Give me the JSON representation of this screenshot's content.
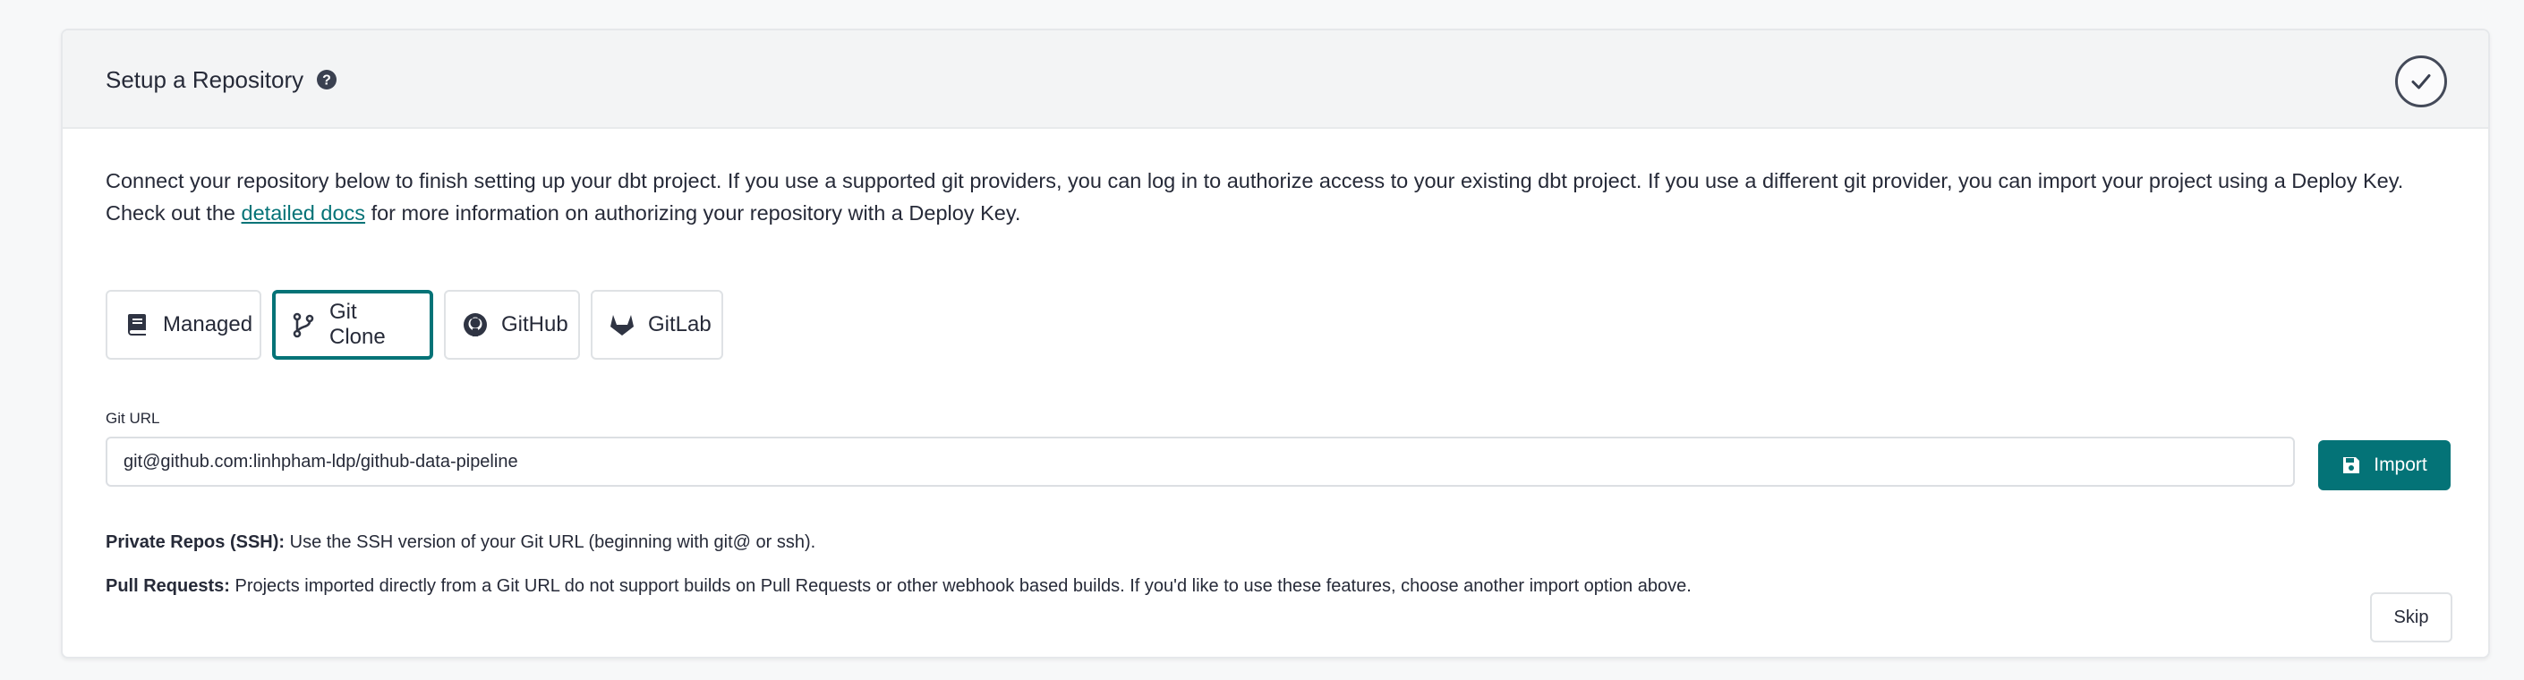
{
  "header": {
    "title": "Setup a Repository",
    "help_icon": "question-circle-icon",
    "status_icon": "check-circle-icon"
  },
  "intro": {
    "text_before_link": "Connect your repository below to finish setting up your dbt project. If you use a supported git providers, you can log in to authorize access to your existing dbt project. If you use a different git provider, you can import your project using a Deploy Key. Check out the ",
    "link_text": "detailed docs",
    "text_after_link": " for more information on authorizing your repository with a Deploy Key."
  },
  "options": [
    {
      "label": "Managed",
      "icon": "book-icon",
      "selected": false
    },
    {
      "label": "Git Clone",
      "icon": "git-branch-icon",
      "selected": true
    },
    {
      "label": "GitHub",
      "icon": "github-icon",
      "selected": false
    },
    {
      "label": "GitLab",
      "icon": "gitlab-icon",
      "selected": false
    }
  ],
  "git_url": {
    "label": "Git URL",
    "value": "git@github.com:linhpham-ldp/github-data-pipeline"
  },
  "import_button": {
    "label": "Import",
    "icon": "save-icon"
  },
  "help": {
    "ssh_title": "Private Repos (SSH):",
    "ssh_text": " Use the SSH version of your Git URL (beginning with git@ or ssh).",
    "pr_title": "Pull Requests:",
    "pr_text": " Projects imported directly from a Git URL do not support builds on Pull Requests or other webhook based builds. If you'd like to use these features, choose another import option above."
  },
  "skip_button": {
    "label": "Skip"
  },
  "colors": {
    "accent": "#047377",
    "header_bg": "#f3f4f5",
    "text": "#262a38"
  }
}
